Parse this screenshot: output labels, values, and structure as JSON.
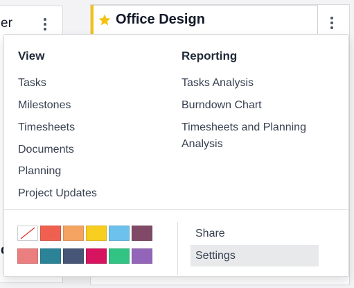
{
  "background": {
    "left_card": {
      "title_fragment": "er",
      "lower_fragment": "d"
    },
    "right_card": {
      "title": "Office Design",
      "favorite": true
    }
  },
  "menu": {
    "view": {
      "title": "View",
      "items": [
        "Tasks",
        "Milestones",
        "Timesheets",
        "Documents",
        "Planning",
        "Project Updates"
      ]
    },
    "reporting": {
      "title": "Reporting",
      "items": [
        "Tasks Analysis",
        "Burndown Chart",
        "Timesheets and Planning",
        "Analysis"
      ]
    },
    "colors": [
      "none",
      "#f06050",
      "#f4a460",
      "#f7cd1f",
      "#6cc1ed",
      "#814968",
      "#eb7e7f",
      "#2c8397",
      "#475577",
      "#d6145f",
      "#30c381",
      "#9365b8"
    ],
    "actions": [
      {
        "label": "Share",
        "active": false
      },
      {
        "label": "Settings",
        "active": true
      }
    ]
  },
  "colors": {
    "accent": "#f4c20d",
    "hover_bg": "#e8e9eb"
  }
}
